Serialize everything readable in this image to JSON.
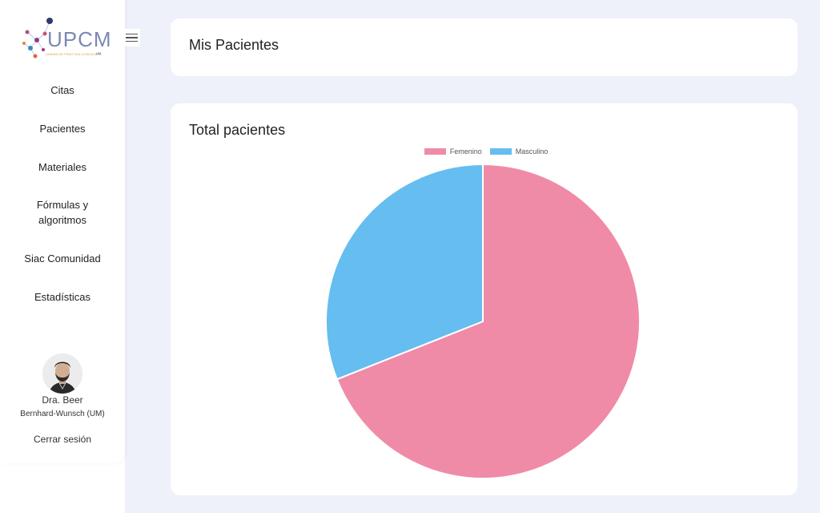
{
  "sidebar": {
    "logo_text": "UPCM",
    "logo_subtitle": "UNIDAD DE PRÁCTICA CLÍNICA MÉDICA",
    "logo_tag": "UM",
    "items": [
      {
        "label": "Citas"
      },
      {
        "label": "Pacientes"
      },
      {
        "label": "Materiales"
      },
      {
        "label": "Fórmulas y algoritmos"
      },
      {
        "label": "Siac Comunidad"
      },
      {
        "label": "Estadísticas"
      }
    ],
    "user": {
      "name": "Dra. Beer",
      "org": "Bernhard-Wunsch (UM)"
    },
    "logout_label": "Cerrar sesión"
  },
  "header": {
    "title": "Mis Pacientes"
  },
  "chart_card": {
    "title": "Total pacientes"
  },
  "chart_data": {
    "type": "pie",
    "title": "Total pacientes",
    "categories": [
      "Femenino",
      "Masculino"
    ],
    "values": [
      69,
      31
    ],
    "colors": [
      "#f08ba7",
      "#66bdf0"
    ],
    "legend": "top"
  }
}
